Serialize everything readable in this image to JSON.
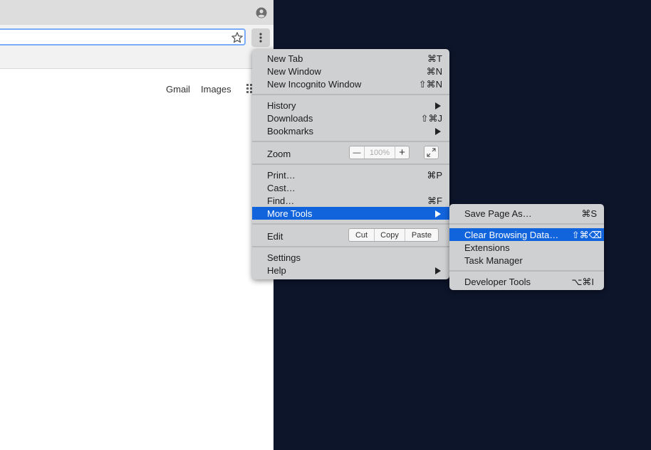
{
  "page_links": {
    "gmail": "Gmail",
    "images": "Images"
  },
  "main_menu": {
    "new_tab": {
      "label": "New Tab",
      "shortcut": "⌘T"
    },
    "new_window": {
      "label": "New Window",
      "shortcut": "⌘N"
    },
    "new_incognito": {
      "label": "New Incognito Window",
      "shortcut": "⇧⌘N"
    },
    "history": {
      "label": "History"
    },
    "downloads": {
      "label": "Downloads",
      "shortcut": "⇧⌘J"
    },
    "bookmarks": {
      "label": "Bookmarks"
    },
    "zoom": {
      "label": "Zoom",
      "minus": "—",
      "value": "100%",
      "plus": "+"
    },
    "print": {
      "label": "Print…",
      "shortcut": "⌘P"
    },
    "cast": {
      "label": "Cast…"
    },
    "find": {
      "label": "Find…",
      "shortcut": "⌘F"
    },
    "more_tools": {
      "label": "More Tools"
    },
    "edit": {
      "label": "Edit",
      "cut": "Cut",
      "copy": "Copy",
      "paste": "Paste"
    },
    "settings": {
      "label": "Settings"
    },
    "help": {
      "label": "Help"
    }
  },
  "sub_menu": {
    "save_page": {
      "label": "Save Page As…",
      "shortcut": "⌘S"
    },
    "clear_browsing": {
      "label": "Clear Browsing Data…",
      "shortcut": "⇧⌘⌫"
    },
    "extensions": {
      "label": "Extensions"
    },
    "task_manager": {
      "label": "Task Manager"
    },
    "developer_tools": {
      "label": "Developer Tools",
      "shortcut": "⌥⌘I"
    }
  },
  "colors": {
    "highlight": "#1264dc",
    "menu_bg": "#cfd0d2",
    "desktop_bg": "#0d152b"
  }
}
